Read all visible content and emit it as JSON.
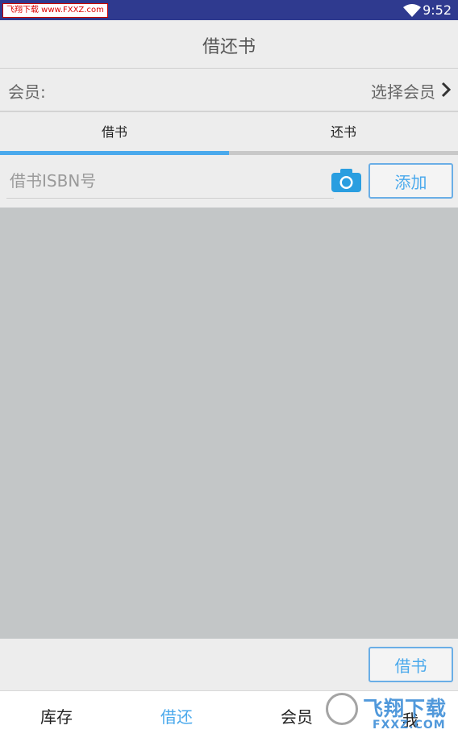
{
  "status_bar": {
    "watermark": "飞翔下载 www.FXXZ.com",
    "time": "9:52"
  },
  "app_bar": {
    "title": "借还书"
  },
  "member": {
    "label": "会员:",
    "select_label": "选择会员"
  },
  "tabs": [
    {
      "label": "借书",
      "active": true
    },
    {
      "label": "还书",
      "active": false
    }
  ],
  "isbn": {
    "placeholder": "借书ISBN号",
    "value": "",
    "add_label": "添加"
  },
  "book_list": {
    "items": []
  },
  "actions": {
    "borrow_label": "借书"
  },
  "bottom_nav": {
    "items": [
      {
        "label": "库存",
        "active": false
      },
      {
        "label": "借还",
        "active": true
      },
      {
        "label": "会员",
        "active": false
      },
      {
        "label": "我",
        "active": false
      }
    ]
  },
  "watermark_logo": {
    "text": "飞翔下载",
    "sub": "FXXZ.COM"
  },
  "colors": {
    "status_bar": "#2f3a8f",
    "accent": "#4aa9ec",
    "background": "#ededed",
    "list_background": "#c3c6c7"
  }
}
